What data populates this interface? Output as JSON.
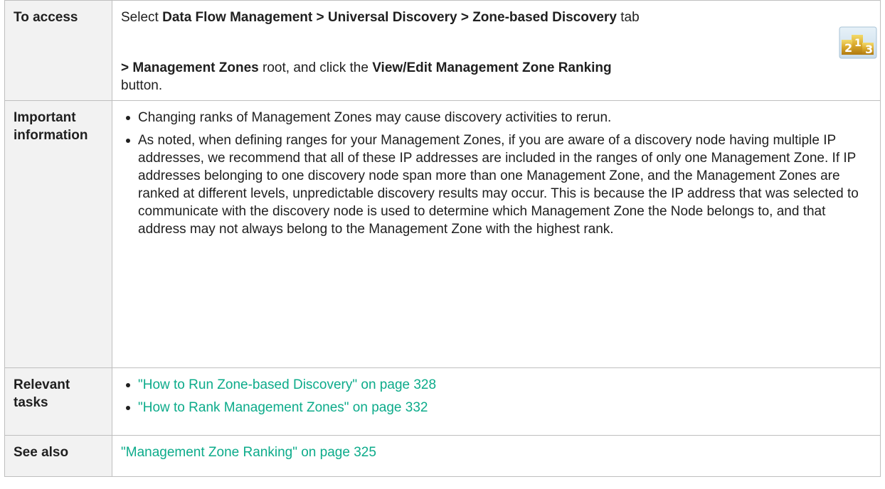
{
  "rows": {
    "access": {
      "header": "To access",
      "select": "Select ",
      "path": "Data Flow Management > Universal Discovery > Zone-based Discovery",
      "tab": " tab",
      "mz_root": "> Management Zones",
      "root_click": " root, and click the ",
      "button_name": "View/Edit Management Zone Ranking",
      "button_word": "button.",
      "icon_text": "2¹3"
    },
    "info": {
      "header": "Important information",
      "bullets": [
        "Changing ranks of Management Zones may cause discovery activities to rerun.",
        "As noted, when defining ranges for your Management Zones, if you are aware of a discovery node having multiple IP addresses, we recommend that all of these IP addresses are included in the ranges of only one Management Zone. If IP addresses belonging to one discovery node span more than one Management Zone, and the Management Zones are ranked at different levels, unpredictable discovery results may occur. This is because the IP address that was selected to communicate with the discovery node is used to determine which Management Zone the Node belongs to, and that address may not always belong to the Management Zone with the highest rank."
      ]
    },
    "tasks": {
      "header": "Relevant tasks",
      "links": [
        "\"How to Run Zone-based Discovery\" on page 328",
        "\"How to Rank Management Zones\" on page 332"
      ]
    },
    "see_also": {
      "header": "See also",
      "link": "\"Management Zone Ranking\" on page 325"
    }
  },
  "colors": {
    "link": "#0cab8a",
    "header_bg": "#f2f2f2",
    "border": "#bfbfbf"
  }
}
